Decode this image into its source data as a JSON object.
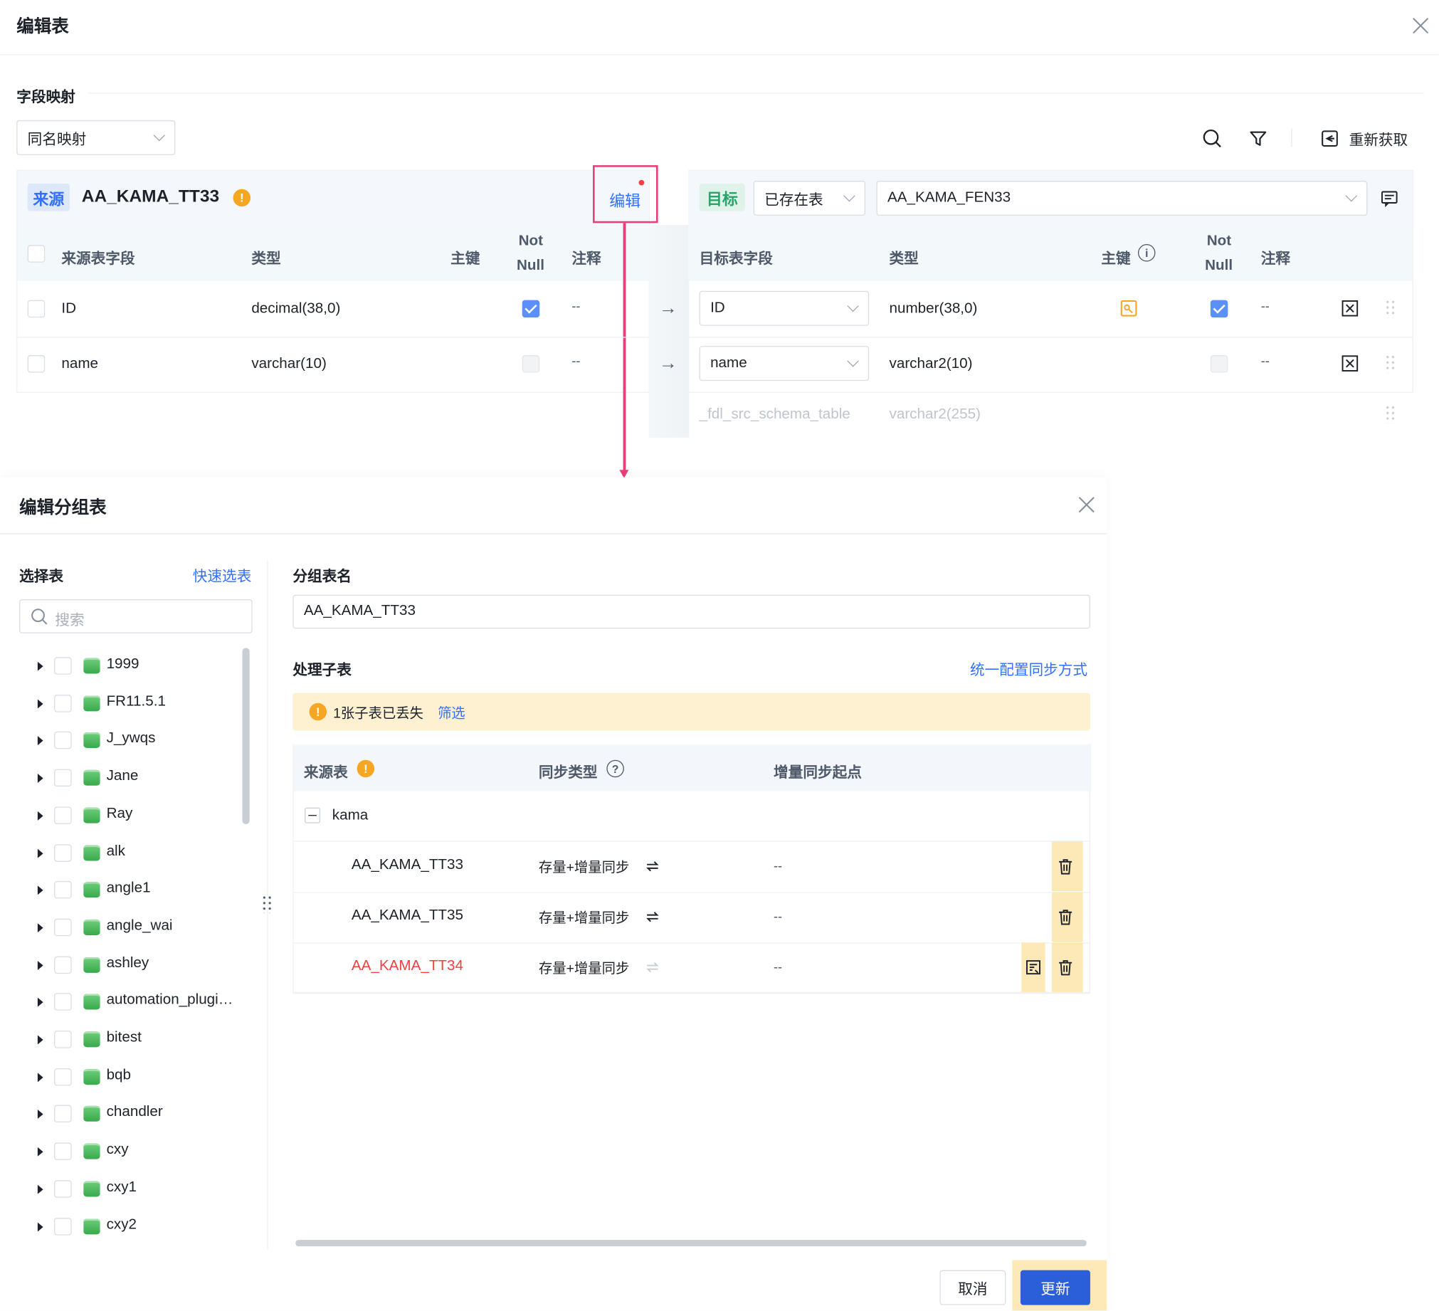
{
  "outer_dialog": {
    "title": "编辑表",
    "section_title": "字段映射",
    "mapping_mode": "同名映射",
    "refetch_label": "重新获取",
    "source": {
      "tag": "来源",
      "table_name": "AA_KAMA_TT33",
      "edit_link": "编辑",
      "headers": {
        "field": "来源表字段",
        "type": "类型",
        "pk": "主键",
        "notnull_1": "Not",
        "notnull_2": "Null",
        "comment": "注释"
      },
      "rows": [
        {
          "field": "ID",
          "type": "decimal(38,0)",
          "not_null": true,
          "comment": "--"
        },
        {
          "field": "name",
          "type": "varchar(10)",
          "not_null": false,
          "comment": "--"
        }
      ]
    },
    "target": {
      "tag": "目标",
      "table_mode": "已存在表",
      "table_name": "AA_KAMA_FEN33",
      "headers": {
        "field": "目标表字段",
        "type": "类型",
        "pk": "主键",
        "notnull_1": "Not",
        "notnull_2": "Null",
        "comment": "注释"
      },
      "rows": [
        {
          "field": "ID",
          "type": "number(38,0)",
          "not_null": true,
          "comment": "--"
        },
        {
          "field": "name",
          "type": "varchar2(10)",
          "not_null": false,
          "comment": "--"
        },
        {
          "field": "_fdl_src_schema_table",
          "type": "varchar2(255)"
        }
      ]
    }
  },
  "inner_dialog": {
    "title": "编辑分组表",
    "left": {
      "title": "选择表",
      "quick_select": "快速选表",
      "search_placeholder": "搜索",
      "tree": [
        "1999",
        "FR11.5.1",
        "J_ywqs",
        "Jane",
        "Ray",
        "alk",
        "angle1",
        "angle_wai",
        "ashley",
        "automation_plugi…",
        "bitest",
        "bqb",
        "chandler",
        "cxy",
        "cxy1",
        "cxy2"
      ]
    },
    "right": {
      "group_name_label": "分组表名",
      "group_name_value": "AA_KAMA_TT33",
      "sub_tables_label": "处理子表",
      "unify_link": "统一配置同步方式",
      "alert_text": "1张子表已丢失",
      "alert_link": "筛选",
      "headers": {
        "source": "来源表",
        "sync_type": "同步类型",
        "inc_start": "增量同步起点"
      },
      "group": "kama",
      "rows": [
        {
          "name": "AA_KAMA_TT33",
          "sync": "存量+增量同步",
          "start": "--",
          "lost": false
        },
        {
          "name": "AA_KAMA_TT35",
          "sync": "存量+增量同步",
          "start": "--",
          "lost": false
        },
        {
          "name": "AA_KAMA_TT34",
          "sync": "存量+增量同步",
          "start": "--",
          "lost": true
        }
      ]
    },
    "footer": {
      "cancel": "取消",
      "update": "更新"
    }
  },
  "colors": {
    "accent": "#3370ff",
    "primary_button": "#2b5fd9",
    "highlight": "#e83e7a",
    "warning": "#f5a623",
    "lost": "#f53f3f",
    "yellow_hl": "#fde8b8"
  }
}
